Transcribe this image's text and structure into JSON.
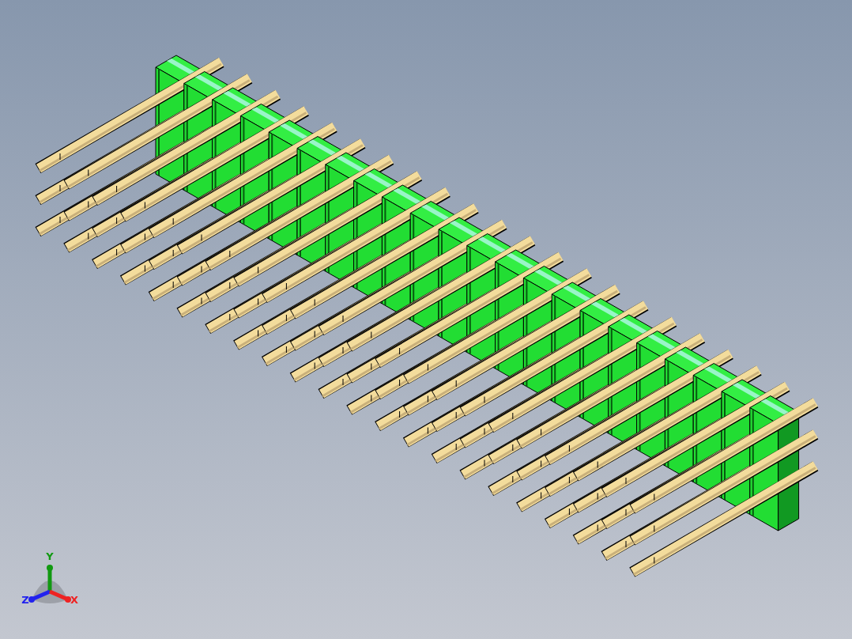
{
  "viewport": {
    "triad": {
      "axes": [
        {
          "label": "Y",
          "kind": "up",
          "color": "#119911"
        },
        {
          "label": "Z",
          "kind": "down-left",
          "color": "#2222ee"
        },
        {
          "label": "X",
          "kind": "down-right",
          "color": "#ee2222"
        }
      ]
    }
  }
}
